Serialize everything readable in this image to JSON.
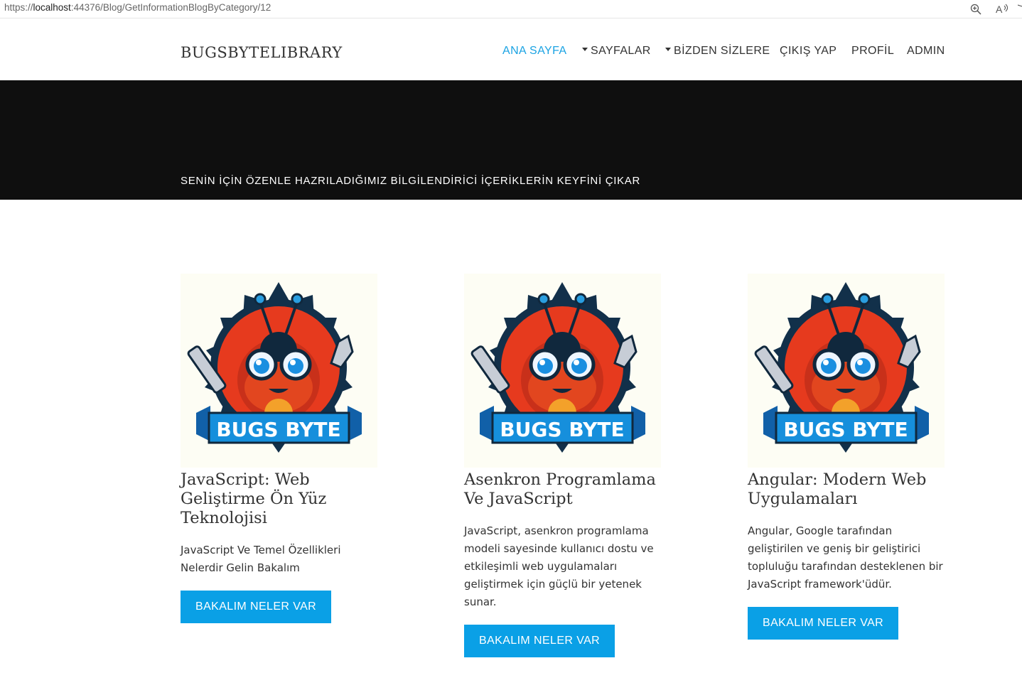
{
  "browser": {
    "url_proto": "https://",
    "url_host": "localhost",
    "url_rest": ":44376/Blog/GetInformationBlogByCategory/12",
    "icons": [
      "zoom-icon",
      "read-aloud-icon"
    ]
  },
  "nav": {
    "brand": "BUGSBYTELIBRARY",
    "items": [
      {
        "label": "ANA SAYFA",
        "active": true,
        "dropdown": false
      },
      {
        "label": "SAYFALAR",
        "active": false,
        "dropdown": true
      },
      {
        "label": "BİZDEN SİZLERE",
        "active": false,
        "dropdown": true
      },
      {
        "label": "ÇIKIŞ YAP",
        "active": false,
        "dropdown": false
      },
      {
        "label": "PROFİL",
        "active": false,
        "dropdown": false
      },
      {
        "label": "ADMIN",
        "active": false,
        "dropdown": false
      }
    ]
  },
  "hero": {
    "tagline": "SENİN İÇİN ÖZENLE HAZRILADIĞIMIZ BİLGİLENDİRİCİ İÇERİKLERİN KEYFİNİ ÇIKAR"
  },
  "cards": [
    {
      "logo_text": "BUGS BYTE",
      "title": "JavaScript: Web Geliştirme Ön Yüz Teknolojisi",
      "description": "JavaScript Ve Temel Özellikleri Nelerdir Gelin Bakalım",
      "button": "BAKALIM NELER VAR"
    },
    {
      "logo_text": "BUGS BYTE",
      "title": "Asenkron Programlama Ve JavaScript",
      "description": "JavaScript, asenkron programlama modeli sayesinde kullanıcı dostu ve etkileşimli web uygulamaları geliştirmek için güçlü bir yetenek sunar.",
      "button": "BAKALIM NELER VAR"
    },
    {
      "logo_text": "BUGS BYTE",
      "title": "Angular: Modern Web Uygulamaları",
      "description": "Angular, Google tarafından geliştirilen ve geniş bir geliştirici topluluğu tarafından desteklenen bir JavaScript framework'üdür.",
      "button": "BAKALIM NELER VAR"
    }
  ],
  "colors": {
    "accent": "#0aa0e6",
    "active_nav": "#1ba3e3",
    "hero_bg": "#0f0f0f"
  }
}
